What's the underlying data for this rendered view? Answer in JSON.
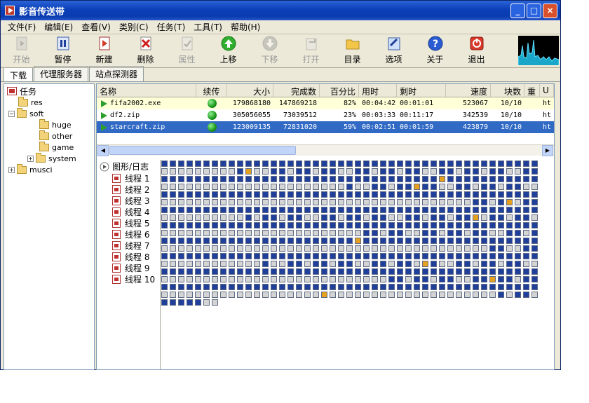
{
  "window": {
    "title": "影音传送带",
    "buttons": [
      "_",
      "□",
      "×"
    ]
  },
  "menu": [
    "文件(F)",
    "编辑(E)",
    "查看(V)",
    "类别(C)",
    "任务(T)",
    "工具(T)",
    "帮助(H)"
  ],
  "toolbar": [
    {
      "label": "开始",
      "icon": "start-icon",
      "enabled": false
    },
    {
      "label": "暂停",
      "icon": "pause-icon",
      "enabled": true
    },
    {
      "label": "新建",
      "icon": "new-icon",
      "enabled": true
    },
    {
      "label": "删除",
      "icon": "delete-icon",
      "enabled": true
    },
    {
      "label": "属性",
      "icon": "properties-icon",
      "enabled": false
    },
    {
      "label": "上移",
      "icon": "move-up-icon",
      "enabled": true
    },
    {
      "label": "下移",
      "icon": "move-down-icon",
      "enabled": false
    },
    {
      "label": "打开",
      "icon": "open-icon",
      "enabled": false
    },
    {
      "label": "目录",
      "icon": "folder-icon",
      "enabled": true
    },
    {
      "label": "选项",
      "icon": "options-icon",
      "enabled": true
    },
    {
      "label": "关于",
      "icon": "about-icon",
      "enabled": true
    },
    {
      "label": "退出",
      "icon": "exit-icon",
      "enabled": true
    }
  ],
  "tabs": [
    "下载",
    "代理服务器",
    "站点探测器"
  ],
  "tree": {
    "root": "任务",
    "nodes": [
      {
        "label": "res",
        "level": 1
      },
      {
        "label": "soft",
        "level": 1
      },
      {
        "label": "huge",
        "level": 2
      },
      {
        "label": "other",
        "level": 2
      },
      {
        "label": "game",
        "level": 2
      },
      {
        "label": "system",
        "level": 2
      },
      {
        "label": "musci",
        "level": 1
      }
    ]
  },
  "list": {
    "columns": [
      "名称",
      "续传",
      "大小",
      "完成数",
      "百分比",
      "用时",
      "剩时",
      "速度",
      "块数",
      "重",
      "U"
    ],
    "rows": [
      {
        "name": "fifa2002.exe",
        "size": "179868180",
        "done": "147869218",
        "percent": "82%",
        "elapsed": "00:04:42",
        "remaining": "00:01:01",
        "speed": "523067",
        "blocks": "10/10",
        "url": "ht"
      },
      {
        "name": "df2.zip",
        "size": "305056055",
        "done": "73039512",
        "percent": "23%",
        "elapsed": "00:03:33",
        "remaining": "00:11:17",
        "speed": "342539",
        "blocks": "10/10",
        "url": "ht"
      },
      {
        "name": "starcraft.zip",
        "size": "123009135",
        "done": "72831020",
        "percent": "59%",
        "elapsed": "00:02:51",
        "remaining": "00:01:59",
        "speed": "423879",
        "blocks": "10/10",
        "url": "ht"
      }
    ]
  },
  "graph_log": {
    "header": "图形/日志",
    "threads": [
      "线程 1",
      "线程 2",
      "线程 3",
      "线程 4",
      "线程 5",
      "线程 6",
      "线程 7",
      "线程 8",
      "线程 9",
      "线程 10"
    ]
  },
  "colors": {
    "done": "#1f3f9a",
    "pending": "#d4d4d4",
    "active": "#e6a020",
    "selection": "#316ac5"
  }
}
